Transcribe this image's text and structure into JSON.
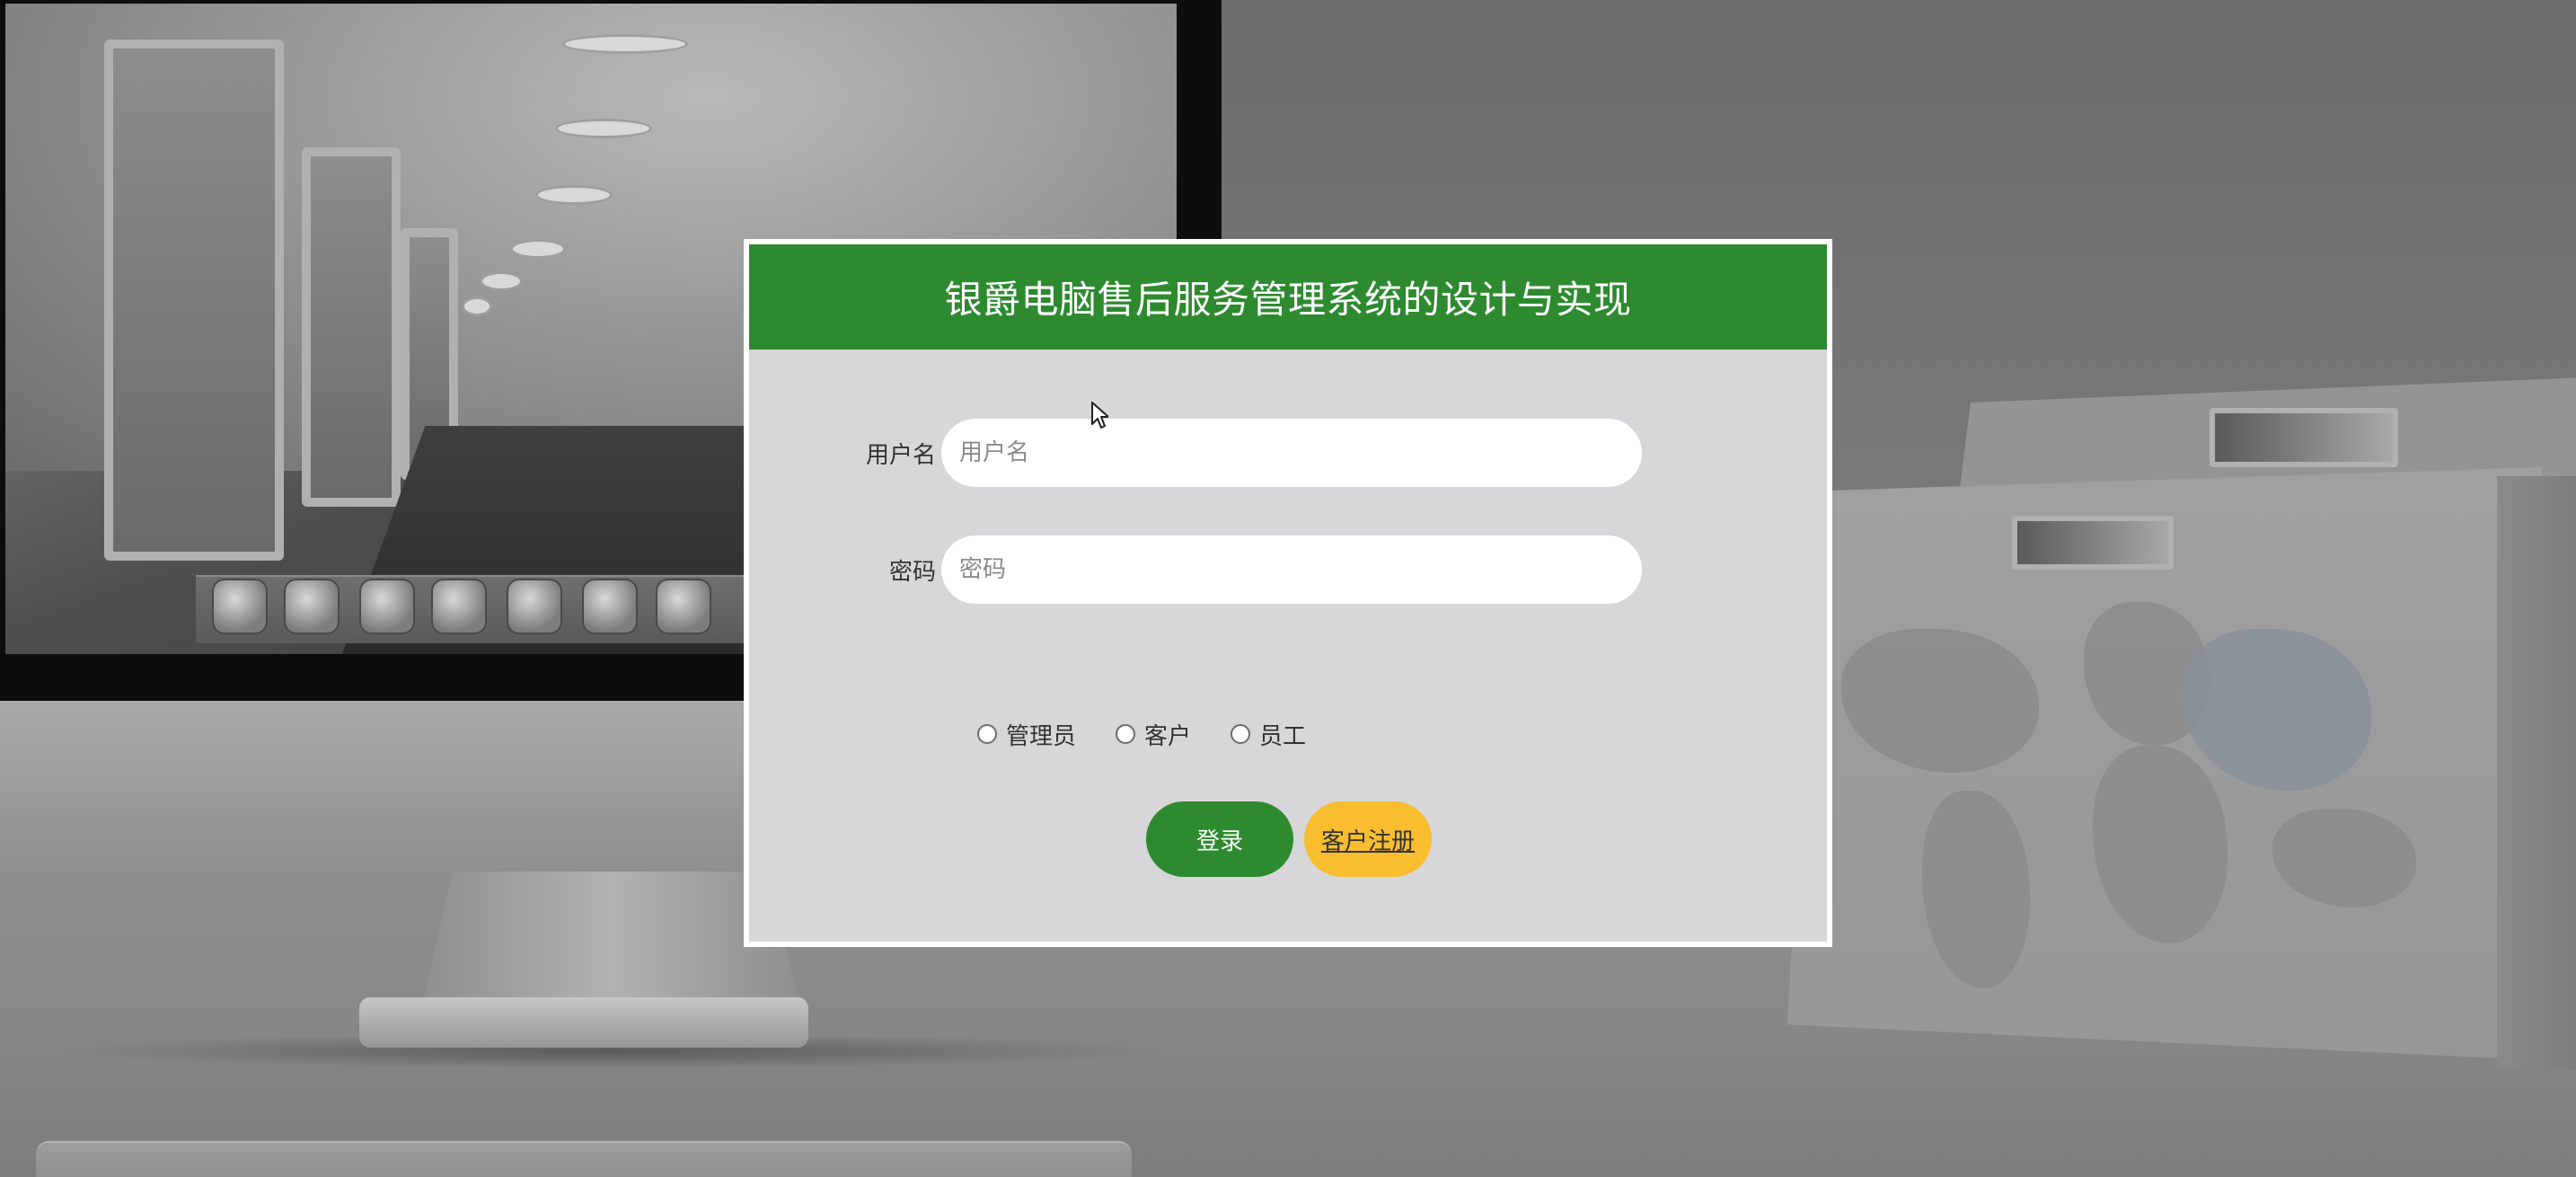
{
  "login": {
    "title": "银爵电脑售后服务管理系统的设计与实现",
    "username_label": "用户名",
    "username_placeholder": "用户名",
    "username_value": "",
    "password_label": "密码",
    "password_placeholder": "密码",
    "password_value": "",
    "roles": [
      {
        "label": "管理员",
        "selected": false
      },
      {
        "label": "客户",
        "selected": false
      },
      {
        "label": "员工",
        "selected": false
      }
    ],
    "login_button": "登录",
    "register_button": "客户注册"
  },
  "colors": {
    "header_green": "#2d8a2f",
    "button_green": "#2d8a2f",
    "button_yellow": "#f8be2f",
    "panel_bg": "#d7d6d9"
  },
  "icons": {
    "cursor": "mouse-pointer-icon",
    "dock_icons": [
      "imac-icon",
      "ie-icon",
      "finder-icon",
      "messenger-icon",
      "word-icon",
      "globe-icon",
      "play-icon"
    ]
  }
}
